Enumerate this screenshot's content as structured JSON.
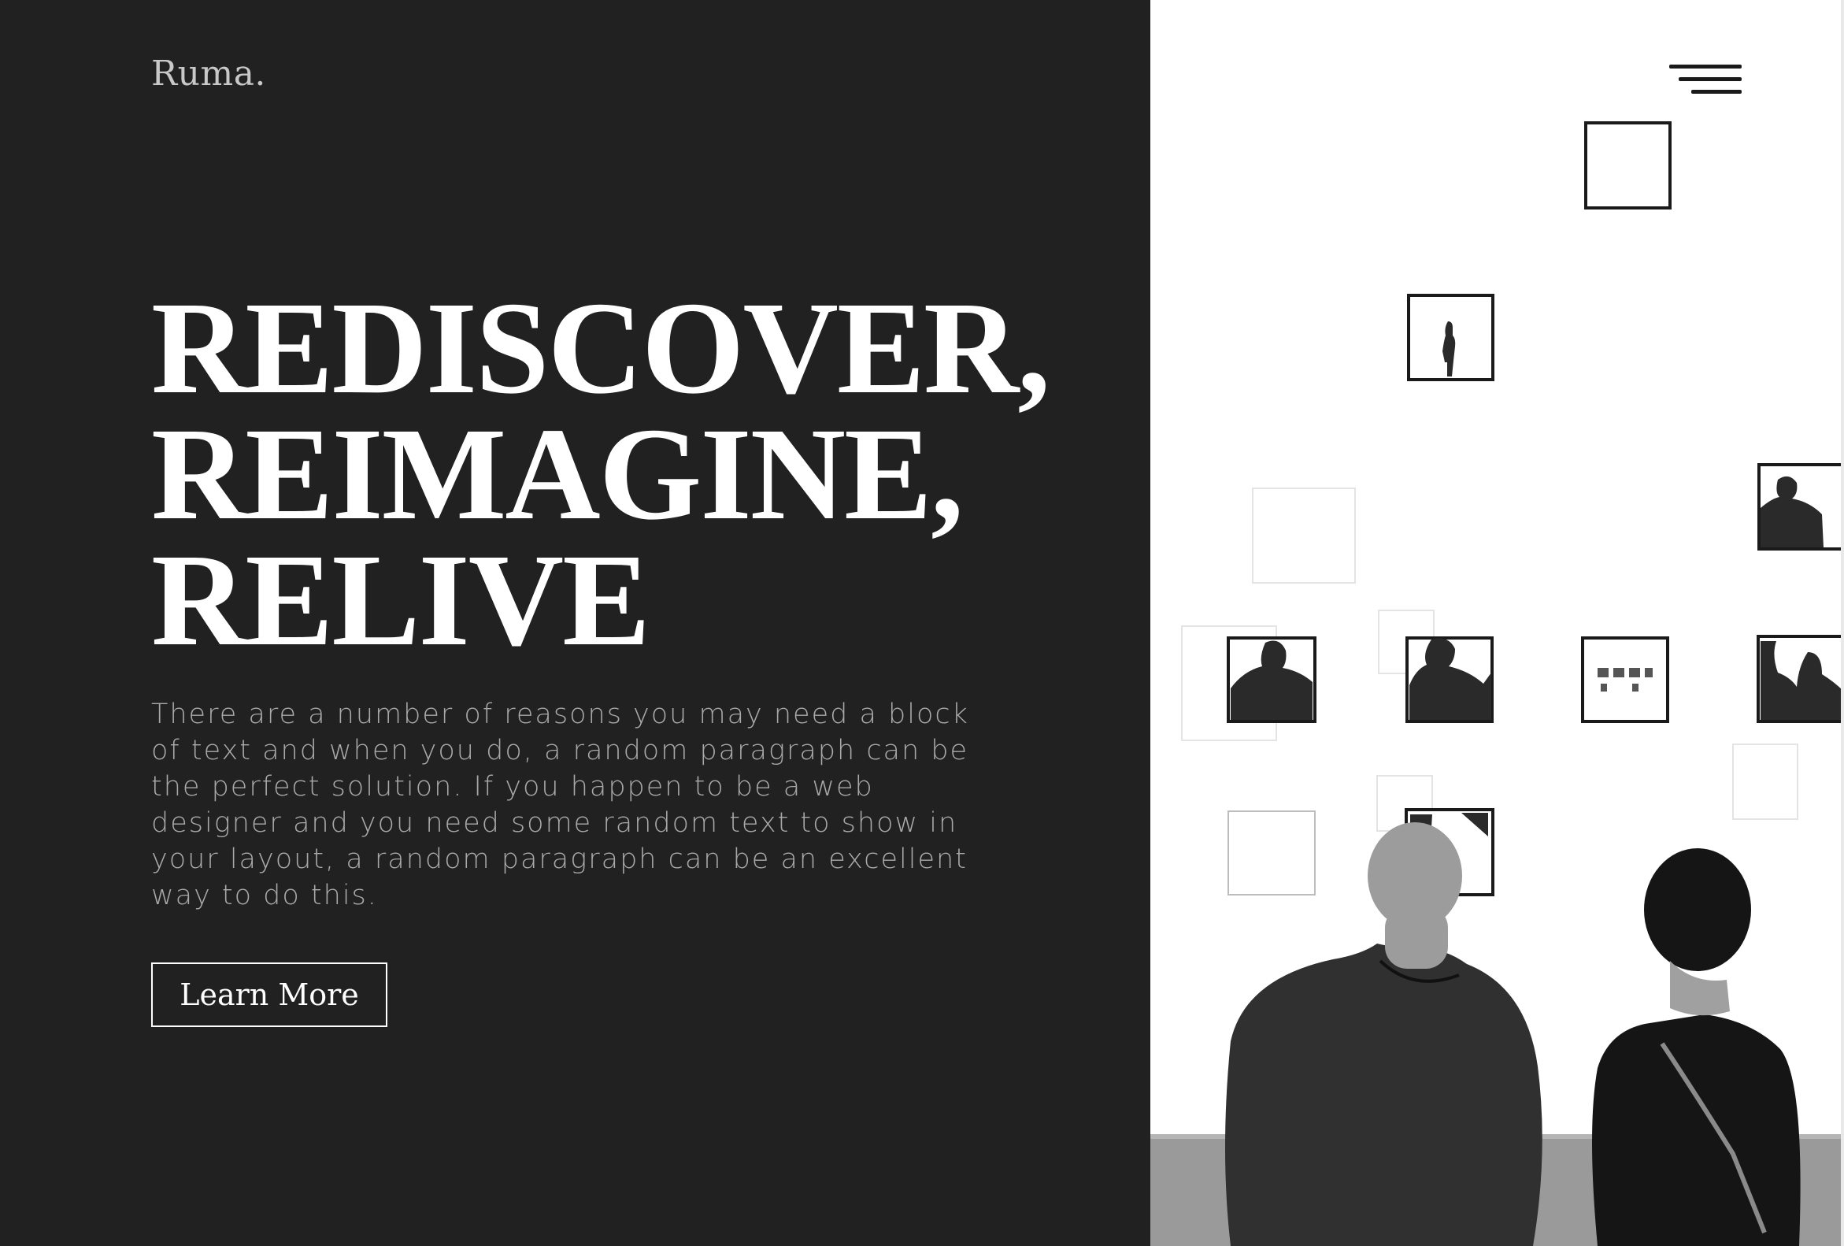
{
  "brand": {
    "logo_text": "Ruma."
  },
  "hero": {
    "headline_lines": [
      "REDISCOVER,",
      "REIMAGINE,",
      "RELIVE"
    ],
    "description": "There are a number of reasons you may need a block of text and when you do, a random paragraph can be the perfect solution. If you happen to be a web designer and you need some random text to show in your layout, a random paragraph can be an excellent way to do this.",
    "cta_label": "Learn More"
  },
  "nav": {
    "menu_icon": "hamburger-menu-icon"
  },
  "colors": {
    "panel_bg": "#212121",
    "headline": "#ffffff",
    "body_text": "#a9a9a9",
    "logo": "#c8c8c8"
  }
}
